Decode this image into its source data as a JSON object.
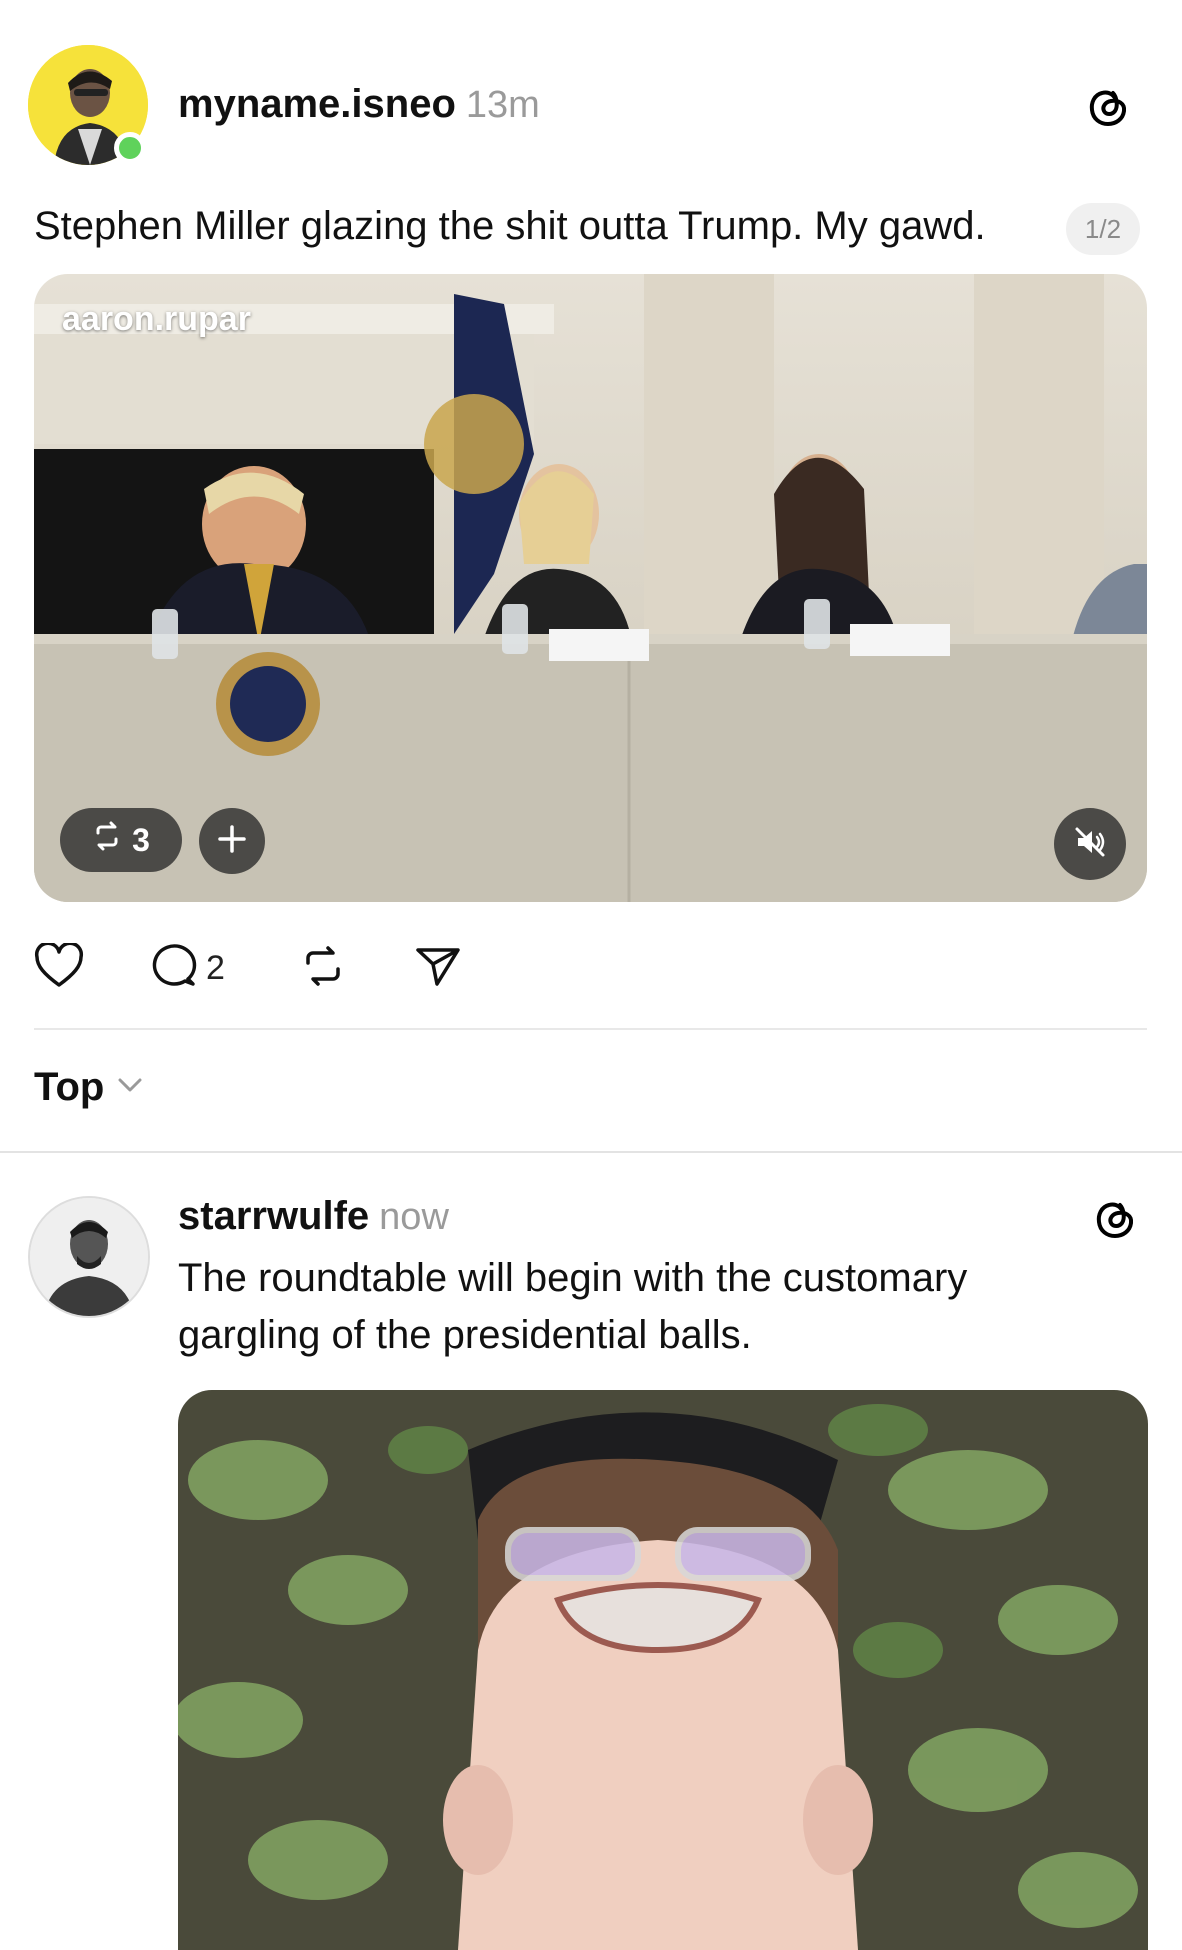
{
  "post": {
    "username": "myname.isneo",
    "time": "13m",
    "text": "Stephen Miller glazing the shit outta Trump. My gawd.",
    "page_badge": "1/2",
    "media": {
      "credit": "aaron.rupar",
      "repost_count": "3"
    },
    "actions": {
      "like_count": "",
      "reply_count": "2",
      "repost_count": "",
      "share_count": ""
    }
  },
  "sort": {
    "label": "Top"
  },
  "reply": {
    "username": "starrwulfe",
    "time": "now",
    "text_line1": "The roundtable will begin with the customary",
    "text_line2": "gargling of the presidential balls."
  },
  "colors": {
    "avatar_ring": "#f6e23a",
    "online": "#5fd25b",
    "muted_text": "#9a9a9a"
  },
  "icons": [
    "threads-icon",
    "heart-icon",
    "comment-icon",
    "repost-icon",
    "send-icon",
    "chevron-down-icon",
    "plus-icon",
    "mute-icon"
  ]
}
